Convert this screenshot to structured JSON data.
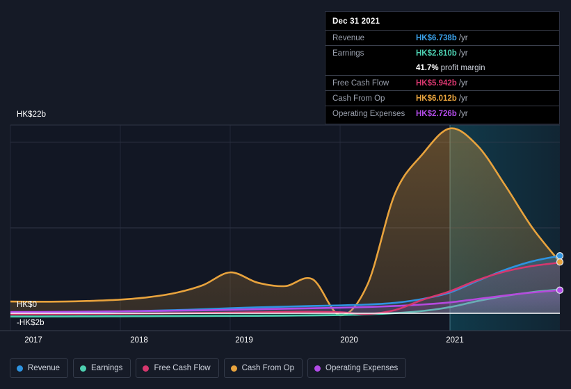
{
  "tooltip": {
    "title": "Dec 31 2021",
    "rows": [
      {
        "label": "Revenue",
        "value": "HK$6.738b",
        "unit": "/yr",
        "color": "#3aa0e8"
      },
      {
        "label": "Earnings",
        "value": "HK$2.810b",
        "unit": "/yr",
        "color": "#4dd0b1"
      },
      {
        "label": "",
        "value": "41.7%",
        "unit": "",
        "note": "profit margin",
        "color": "#ffffff"
      },
      {
        "label": "Free Cash Flow",
        "value": "HK$5.942b",
        "unit": "/yr",
        "color": "#d6376e"
      },
      {
        "label": "Cash From Op",
        "value": "HK$6.012b",
        "unit": "/yr",
        "color": "#e8a33d"
      },
      {
        "label": "Operating Expenses",
        "value": "HK$2.726b",
        "unit": "/yr",
        "color": "#b24be8"
      }
    ]
  },
  "axis": {
    "y_top_label": "HK$22b",
    "y_zero_label": "HK$0",
    "y_bottom_label": "-HK$2b",
    "x_ticks": [
      "2017",
      "2018",
      "2019",
      "2020",
      "2021"
    ]
  },
  "legend": {
    "items": [
      {
        "label": "Revenue",
        "color": "#2e93e0"
      },
      {
        "label": "Earnings",
        "color": "#4dd0b1"
      },
      {
        "label": "Free Cash Flow",
        "color": "#d6376e"
      },
      {
        "label": "Cash From Op",
        "color": "#e8a33d"
      },
      {
        "label": "Operating Expenses",
        "color": "#b24be8"
      }
    ]
  },
  "chart_data": {
    "type": "area",
    "title": "",
    "xlabel": "",
    "ylabel": "HK$ (billions)",
    "ylim": [
      -2,
      22
    ],
    "xlim": [
      2017.0,
      2022.0
    ],
    "y_gridlines": [
      22,
      20,
      10,
      0
    ],
    "grid": true,
    "legend_position": "bottom",
    "currency": "HK$",
    "unit": "b",
    "forecast_region_start": "2021",
    "x": [
      2017.0,
      2017.25,
      2017.5,
      2017.75,
      2018.0,
      2018.25,
      2018.5,
      2018.75,
      2019.0,
      2019.25,
      2019.5,
      2019.75,
      2020.0,
      2020.25,
      2020.5,
      2020.75,
      2021.0,
      2021.25,
      2021.5,
      2021.75,
      2022.0
    ],
    "x_labels": [
      "2017",
      "",
      "",
      "",
      "2018",
      "",
      "",
      "",
      "2019",
      "",
      "",
      "",
      "2020",
      "",
      "",
      "",
      "2021",
      "",
      "",
      "",
      ""
    ],
    "series": [
      {
        "name": "Revenue",
        "color": "#2e93e0",
        "values": [
          0.05,
          0.08,
          0.12,
          0.18,
          0.25,
          0.32,
          0.4,
          0.5,
          0.62,
          0.72,
          0.8,
          0.88,
          0.95,
          1.05,
          1.25,
          1.7,
          2.45,
          3.8,
          5.1,
          6.1,
          6.738
        ],
        "end_value": "HK$6.738b",
        "end_marker": true
      },
      {
        "name": "Earnings",
        "color": "#4dd0b1",
        "values": [
          -0.35,
          -0.35,
          -0.34,
          -0.33,
          -0.32,
          -0.31,
          -0.3,
          -0.29,
          -0.28,
          -0.27,
          -0.25,
          -0.22,
          -0.18,
          -0.1,
          0.05,
          0.3,
          0.75,
          1.45,
          2.05,
          2.5,
          2.81
        ],
        "end_value": "HK$2.810b",
        "end_marker": false
      },
      {
        "name": "Free Cash Flow",
        "color": "#d6376e",
        "values": [
          -0.1,
          -0.08,
          -0.06,
          -0.04,
          -0.02,
          0.0,
          0.03,
          0.06,
          0.1,
          0.14,
          0.18,
          0.2,
          0.15,
          -0.05,
          0.4,
          1.6,
          2.6,
          3.9,
          4.9,
          5.55,
          5.942
        ],
        "end_value": "HK$5.942b",
        "end_marker": false
      },
      {
        "name": "Cash From Op",
        "color": "#e8a33d",
        "values": [
          1.4,
          1.38,
          1.4,
          1.48,
          1.62,
          1.9,
          2.4,
          3.3,
          4.8,
          3.6,
          3.2,
          4.0,
          -0.2,
          3.4,
          14.0,
          18.6,
          21.6,
          19.6,
          15.0,
          10.0,
          6.012
        ],
        "end_value": "HK$6.012b",
        "end_marker": true
      },
      {
        "name": "Operating Expenses",
        "color": "#b24be8",
        "values": [
          0.18,
          0.19,
          0.21,
          0.23,
          0.26,
          0.29,
          0.33,
          0.38,
          0.44,
          0.5,
          0.56,
          0.62,
          0.68,
          0.76,
          0.88,
          1.05,
          1.3,
          1.7,
          2.1,
          2.45,
          2.726
        ],
        "end_value": "HK$2.726b",
        "end_marker": true
      }
    ]
  }
}
